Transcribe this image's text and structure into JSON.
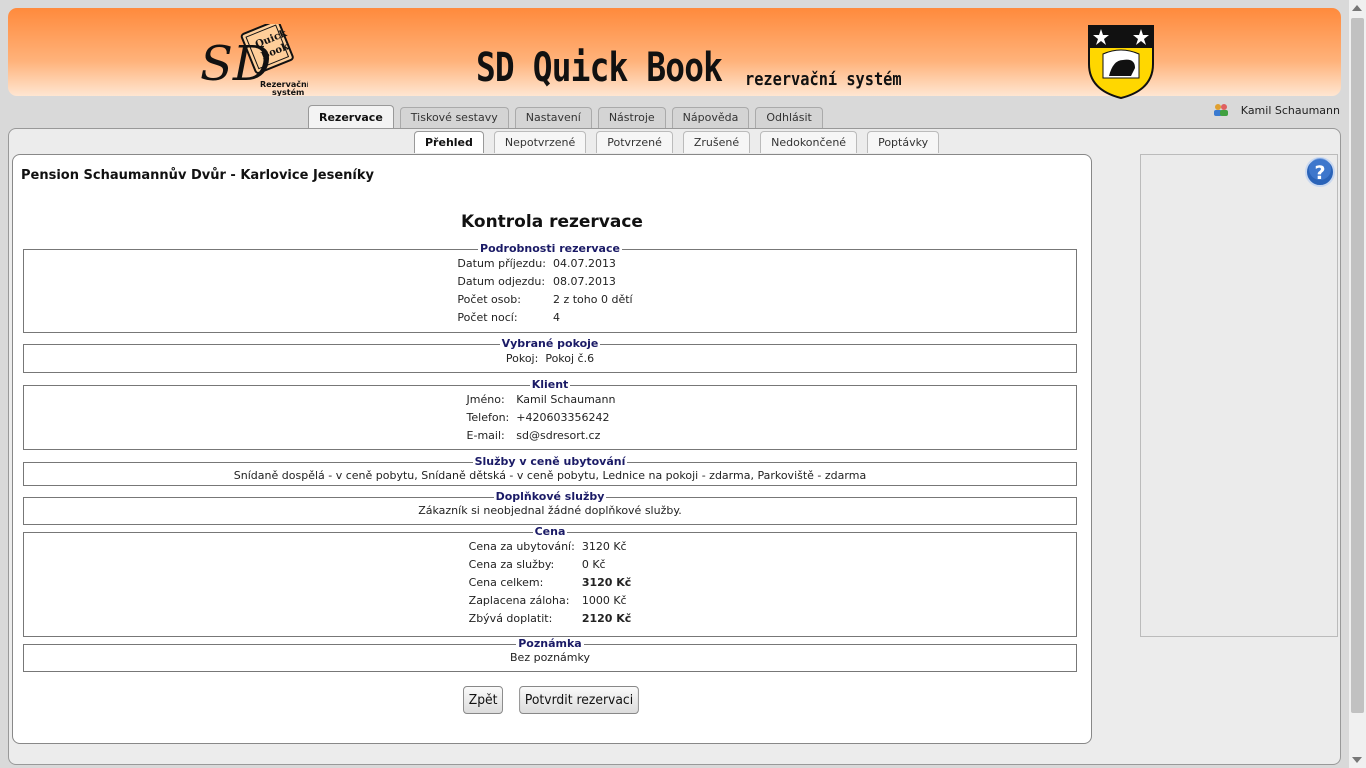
{
  "header": {
    "logo_lines": [
      "SD",
      "Quick",
      "Book",
      "Rezervační",
      "systém"
    ],
    "title": "SD Quick Book",
    "subtitle": "rezervační systém",
    "colors": {
      "banner_top": "#ff8a3c",
      "banner_bottom": "#ffe6d2",
      "legend": "#1a1a66"
    }
  },
  "main_tabs": [
    {
      "label": "Rezervace",
      "active": true
    },
    {
      "label": "Tiskové sestavy"
    },
    {
      "label": "Nastavení"
    },
    {
      "label": "Nástroje"
    },
    {
      "label": "Nápověda"
    },
    {
      "label": "Odhlásit"
    }
  ],
  "user": {
    "name": "Kamil Schaumann",
    "icon": "users-icon"
  },
  "sub_tabs": [
    {
      "label": "Přehled",
      "active": true
    },
    {
      "label": "Nepotvrzené"
    },
    {
      "label": "Potvrzené"
    },
    {
      "label": "Zrušené"
    },
    {
      "label": "Nedokončené"
    },
    {
      "label": "Poptávky"
    }
  ],
  "pension_name": "Pension Schaumannův Dvůr - Karlovice Jeseníky",
  "page_heading": "Kontrola rezervace",
  "sections": {
    "details": {
      "legend": "Podrobnosti rezervace",
      "rows": [
        {
          "label": "Datum příjezdu:",
          "value": "04.07.2013"
        },
        {
          "label": "Datum odjezdu:",
          "value": "08.07.2013"
        },
        {
          "label": "Počet osob:",
          "value": "2 z toho 0 dětí"
        },
        {
          "label": "Počet nocí:",
          "value": "4"
        }
      ]
    },
    "rooms": {
      "legend": "Vybrané pokoje",
      "rows": [
        {
          "label": "Pokoj:",
          "value": "Pokoj č.6"
        }
      ]
    },
    "client": {
      "legend": "Klient",
      "rows": [
        {
          "label": "Jméno:",
          "value": "Kamil Schaumann"
        },
        {
          "label": "Telefon:",
          "value": "+420603356242"
        },
        {
          "label": "E-mail:",
          "value": "sd@sdresort.cz"
        }
      ]
    },
    "services_included": {
      "legend": "Služby v ceně ubytování",
      "text": "Snídaně dospělá - v ceně pobytu, Snídaně dětská - v ceně pobytu, Lednice na pokoji - zdarma, Parkoviště - zdarma"
    },
    "extra_services": {
      "legend": "Doplňkové služby",
      "text": "Zákazník si neobjednal žádné doplňkové služby."
    },
    "price": {
      "legend": "Cena",
      "rows": [
        {
          "label": "Cena za ubytování:",
          "value": "3120 Kč"
        },
        {
          "label": "Cena za služby:",
          "value": "0 Kč"
        },
        {
          "label": "Cena celkem:",
          "value": "3120 Kč",
          "bold": true
        },
        {
          "label": "Zaplacena záloha:",
          "value": "1000 Kč"
        },
        {
          "label": "Zbývá doplatit:",
          "value": "2120 Kč",
          "bold": true
        }
      ]
    },
    "note": {
      "legend": "Poznámka",
      "text": "Bez poznámky"
    }
  },
  "buttons": {
    "back": "Zpět",
    "confirm": "Potvrdit rezervaci"
  },
  "help": {
    "glyph": "?",
    "icon": "help-icon"
  }
}
